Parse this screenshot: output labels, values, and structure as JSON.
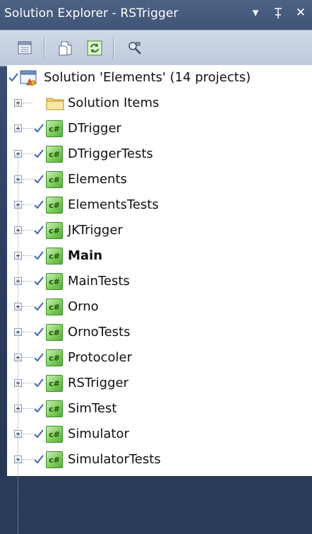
{
  "window": {
    "title": "Solution Explorer - RSTrigger",
    "dropdown_glyph": "▾",
    "pin_glyph": "ꟷ",
    "close_glyph": "✕"
  },
  "toolbar": {
    "buttons": [
      {
        "name": "properties-icon"
      },
      {
        "name": "show-all-files-icon"
      },
      {
        "name": "refresh-icon"
      },
      {
        "name": "class-view-icon"
      }
    ]
  },
  "solution": {
    "label": "Solution 'Elements' (14 projects)"
  },
  "items": [
    {
      "label": "Solution Items",
      "type": "folder"
    },
    {
      "label": "DTrigger",
      "type": "csproj"
    },
    {
      "label": "DTriggerTests",
      "type": "csproj"
    },
    {
      "label": "Elements",
      "type": "csproj"
    },
    {
      "label": "ElementsTests",
      "type": "csproj"
    },
    {
      "label": "JKTrigger",
      "type": "csproj"
    },
    {
      "label": "Main",
      "type": "csproj",
      "bold": true
    },
    {
      "label": "MainTests",
      "type": "csproj"
    },
    {
      "label": "Orno",
      "type": "csproj"
    },
    {
      "label": "OrnoTests",
      "type": "csproj"
    },
    {
      "label": "Protocoler",
      "type": "csproj"
    },
    {
      "label": "RSTrigger",
      "type": "csproj"
    },
    {
      "label": "SimTest",
      "type": "csproj"
    },
    {
      "label": "Simulator",
      "type": "csproj"
    },
    {
      "label": "SimulatorTests",
      "type": "csproj"
    }
  ],
  "csharp_badge": "c#"
}
